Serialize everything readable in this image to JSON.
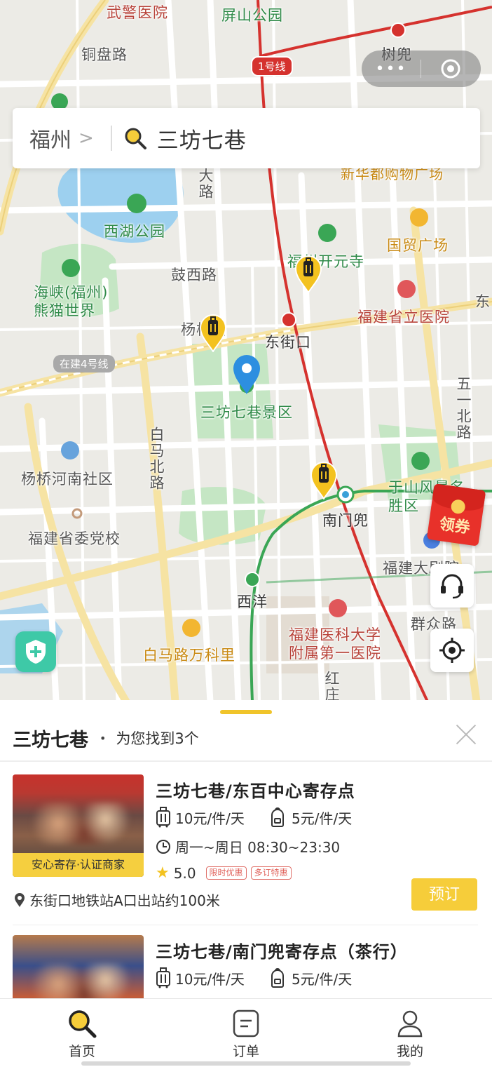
{
  "map": {
    "labels": {
      "wujing": "武警医院",
      "pingshan": "屏山公园",
      "tongpan": "铜盘路",
      "shudou": "树兜",
      "line1": "1号线",
      "xinhua": "新华都购物广场",
      "beida": "北大路",
      "xihu": "西湖公园",
      "kaiyuan": "福州开元寺",
      "guomao": "国贸广场",
      "guxi": "鼓西路",
      "panda": "海峡(福州)熊猫世界",
      "provincial": "福建省立医院",
      "yangqiao": "杨桥路",
      "dongjiekou": "东街口",
      "dong": "东",
      "line4": "在建4号线",
      "sanfang": "三坊七巷景区",
      "wuyi": "五一北路",
      "baima": "白马北路",
      "yangqiaohe": "杨桥河南社区",
      "yushan": "于山风景名胜区",
      "nanmendou": "南门兜",
      "party": "福建省委党校",
      "theatre": "福建大剧院",
      "xiyang": "西洋",
      "qunzhong": "群众路",
      "vanke": "白马路万科里",
      "fuyi": "福建医科大学附属第一医院",
      "hongqiao": "红庄"
    }
  },
  "capsule": {
    "dots": "•••"
  },
  "search": {
    "city": "福州",
    "chevron": ">",
    "query": "三坊七巷"
  },
  "coupon": {
    "label": "领券"
  },
  "sheet": {
    "title": "三坊七巷",
    "dot": "•",
    "count": "为您找到3个",
    "cards": [
      {
        "title": "三坊七巷/东百中心寄存点",
        "tag": "安心寄存·认证商家",
        "price_large": "10元/件/天",
        "price_small": "5元/件/天",
        "hours": "周一~周日 08:30~23:30",
        "rating": "5.0",
        "promo1": "限时优惠",
        "promo2": "多订特惠",
        "distance": "东街口地铁站A口出站约100米",
        "book": "预订"
      },
      {
        "title": "三坊七巷/南门兜寄存点（茶行）",
        "price_large": "10元/件/天",
        "price_small": "5元/件/天"
      }
    ]
  },
  "tabs": [
    {
      "label": "首页",
      "icon": "search-icon"
    },
    {
      "label": "订单",
      "icon": "order-icon"
    },
    {
      "label": "我的",
      "icon": "user-icon"
    }
  ],
  "colors": {
    "accent": "#f6cd3a",
    "metro_red": "#d5322e",
    "metro_green": "#3aa655",
    "map_bg": "#ecebe6"
  }
}
